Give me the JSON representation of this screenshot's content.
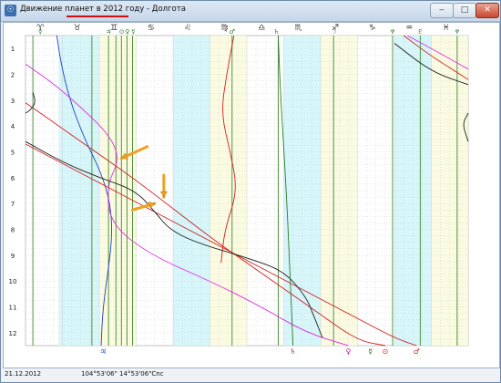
{
  "window": {
    "icon_name": "app-icon",
    "title": "Движение планет в 2012 году - Долгота",
    "minimize_label": "‒",
    "maximize_label": "□",
    "close_label": "✕"
  },
  "zodiac_labels": [
    "♈",
    "♉",
    "♊",
    "♋",
    "♌",
    "♍",
    "♎",
    "♏",
    "♐",
    "♑",
    "♒",
    "♓"
  ],
  "month_labels": [
    "1",
    "2",
    "3",
    "4",
    "5",
    "6",
    "7",
    "8",
    "9",
    "10",
    "11",
    "12"
  ],
  "top_planet_labels": [
    {
      "glyph": "☿",
      "color": "#2a7a2a",
      "pos": 0.4
    },
    {
      "glyph": "♃",
      "color": "#2a7a2a",
      "pos": 2.25
    },
    {
      "glyph": "⊙",
      "color": "#2a7a2a",
      "pos": 2.61
    },
    {
      "glyph": "♀",
      "color": "#2a7a2a",
      "pos": 2.76
    },
    {
      "glyph": "☿",
      "color": "#2a7a2a",
      "pos": 2.92
    },
    {
      "glyph": "♂",
      "color": "#2a7a2a",
      "pos": 5.6
    },
    {
      "glyph": "♄",
      "color": "#2a7a2a",
      "pos": 6.8
    },
    {
      "glyph": "☽",
      "color": "#2a7a2a",
      "pos": 8.35
    },
    {
      "glyph": "♆",
      "color": "#2a7a2a",
      "pos": 9.95
    },
    {
      "glyph": "♇",
      "color": "#2a7a2a",
      "pos": 10.7
    },
    {
      "glyph": "♆",
      "color": "#2a7a2a",
      "pos": 11.7
    }
  ],
  "bottom_planet_labels": [
    {
      "glyph": "♃",
      "color": "#1f3fc0",
      "pos": 2.1
    },
    {
      "glyph": "♄",
      "color": "#b0306a",
      "pos": 7.25
    },
    {
      "glyph": "♀",
      "color": "#b02080",
      "pos": 8.75
    },
    {
      "glyph": "☿",
      "color": "#1a6a1a",
      "pos": 9.35
    },
    {
      "glyph": "⊙",
      "color": "#d02020",
      "pos": 9.75
    },
    {
      "glyph": "♂",
      "color": "#d02020",
      "pos": 10.6
    }
  ],
  "status": {
    "date": "21.12.2012",
    "coords": "104°53'06\"  14°53'06\"Cnc"
  },
  "colors": {
    "cyan_band": "#d6f6fa",
    "yellow_band": "#fbfbe2",
    "green_line": "#3c8a2c",
    "grid": "#c8c8c8",
    "arrow": "#f0a020"
  },
  "chart_data": {
    "type": "line",
    "xlabel": "",
    "ylabel": "",
    "x_domain": "zodiac signs (longitude, 0-12 signs = 0-360°)",
    "y_domain": "months 1-12 of 2012",
    "xlim": [
      0,
      12
    ],
    "ylim": [
      0.5,
      12.5
    ],
    "cyan_bands": [
      [
        0.9,
        2.0
      ],
      [
        4.0,
        5.0
      ],
      [
        7.0,
        8.0
      ],
      [
        10.0,
        11.0
      ]
    ],
    "yellow_bands": [
      [
        2.0,
        3.0
      ],
      [
        5.0,
        6.0
      ],
      [
        8.0,
        9.0
      ],
      [
        11.0,
        12.0
      ]
    ],
    "vertical_lines": [
      0.2,
      1.8,
      2.25,
      2.45,
      2.6,
      2.75,
      2.9,
      5.6,
      6.85,
      8.35,
      9.95,
      10.7,
      11.7
    ],
    "series": [
      {
        "color": "#1f3fc0",
        "points": [
          [
            0.85,
            0.5
          ],
          [
            0.95,
            1.5
          ],
          [
            1.2,
            3
          ],
          [
            1.6,
            4.5
          ],
          [
            2.05,
            5.8
          ],
          [
            2.3,
            7
          ],
          [
            2.35,
            8.2
          ],
          [
            2.25,
            9.5
          ],
          [
            2.1,
            11
          ],
          [
            2.05,
            12.5
          ]
        ]
      },
      {
        "color": "#e030e0",
        "points": [
          [
            0,
            1.6
          ],
          [
            0.8,
            2.4
          ],
          [
            1.6,
            3.4
          ],
          [
            2.3,
            4.4
          ],
          [
            2.55,
            5.3
          ],
          [
            2.2,
            6.3
          ],
          [
            2.3,
            7.8
          ],
          [
            3.4,
            9
          ],
          [
            5,
            10
          ],
          [
            6.4,
            11
          ],
          [
            7.6,
            12
          ],
          [
            8.75,
            12.5
          ]
        ]
      },
      {
        "color": "#e030e0",
        "points": [
          [
            10.35,
            0.5
          ],
          [
            11,
            1
          ],
          [
            12,
            1.8
          ]
        ]
      },
      {
        "color": "#d02020",
        "points": [
          [
            0,
            3.1
          ],
          [
            1,
            4.1
          ],
          [
            2,
            5.1
          ],
          [
            3,
            6.1
          ],
          [
            4,
            7.2
          ],
          [
            5,
            8.3
          ],
          [
            6,
            9.3
          ],
          [
            7,
            10.3
          ],
          [
            8,
            11.3
          ],
          [
            9,
            12.3
          ],
          [
            9.75,
            12.5
          ]
        ]
      },
      {
        "color": "#d02020",
        "points": [
          [
            0,
            4.7
          ],
          [
            1,
            5.45
          ],
          [
            2,
            6.2
          ],
          [
            3,
            6.95
          ],
          [
            4,
            7.7
          ],
          [
            5,
            8.45
          ],
          [
            6,
            9.2
          ],
          [
            7,
            9.95
          ],
          [
            8,
            10.7
          ],
          [
            9,
            11.45
          ],
          [
            10,
            12.2
          ],
          [
            10.6,
            12.5
          ]
        ]
      },
      {
        "color": "#d02020",
        "points": [
          [
            10.25,
            0.5
          ],
          [
            11,
            1.3
          ],
          [
            12,
            2.2
          ]
        ]
      },
      {
        "color": "#d02020",
        "points": [
          [
            5.65,
            0.5
          ],
          [
            5.45,
            2
          ],
          [
            5.3,
            3.5
          ],
          [
            5.55,
            5
          ],
          [
            5.75,
            6.5
          ],
          [
            5.4,
            8
          ],
          [
            5.3,
            9.3
          ]
        ]
      },
      {
        "color": "#202020",
        "points": [
          [
            0,
            4.6
          ],
          [
            1,
            5.4
          ],
          [
            2,
            6
          ],
          [
            3,
            6.5
          ],
          [
            3.55,
            7.4
          ],
          [
            3.9,
            8
          ],
          [
            4.6,
            8.5
          ],
          [
            6,
            9.1
          ],
          [
            7,
            9.6
          ],
          [
            7.6,
            10.6
          ],
          [
            7.8,
            11.3
          ],
          [
            8.05,
            12.2
          ]
        ]
      },
      {
        "color": "#202020",
        "points": [
          [
            10,
            0.8
          ],
          [
            11,
            1.9
          ],
          [
            12,
            2.4
          ]
        ]
      },
      {
        "color": "#202020",
        "points": [
          [
            0.2,
            2.7
          ],
          [
            0.28,
            3.1
          ],
          [
            0.12,
            3.4
          ],
          [
            0,
            3.5
          ]
        ]
      },
      {
        "color": "#202020",
        "points": [
          [
            12,
            3.5
          ],
          [
            11.85,
            3.9
          ],
          [
            11.95,
            4.4
          ],
          [
            12,
            4.6
          ]
        ]
      },
      {
        "color": "#2a7a2a",
        "points": [
          [
            6.85,
            0.5
          ],
          [
            6.92,
            3
          ],
          [
            7.05,
            6
          ],
          [
            7.15,
            9
          ],
          [
            7.25,
            12.5
          ]
        ]
      }
    ],
    "arrows": [
      {
        "from": [
          3.3,
          4.8
        ],
        "to": [
          2.6,
          5.25
        ]
      },
      {
        "from": [
          3.75,
          5.9
        ],
        "to": [
          3.75,
          6.75
        ]
      },
      {
        "from": [
          2.9,
          7.25
        ],
        "to": [
          3.5,
          7.0
        ]
      }
    ]
  }
}
